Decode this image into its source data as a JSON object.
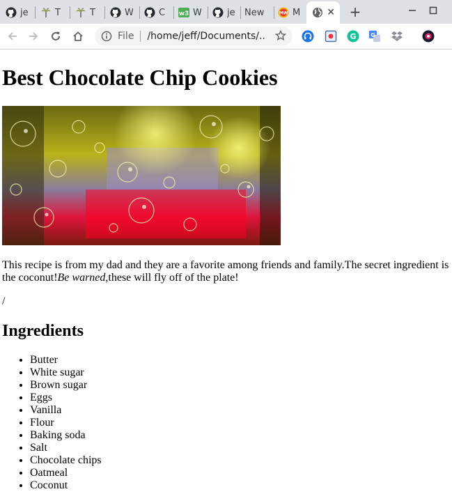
{
  "browser": {
    "tabs": [
      {
        "title": "jeff",
        "icon": "github-icon"
      },
      {
        "title": "T",
        "icon": "palm-tree-icon"
      },
      {
        "title": "T",
        "icon": "palm-tree-icon"
      },
      {
        "title": "W",
        "icon": "github-icon"
      },
      {
        "title": "C",
        "icon": "github-icon"
      },
      {
        "title": "W",
        "icon": "w3-icon"
      },
      {
        "title": "je",
        "icon": "github-icon"
      },
      {
        "title": "New",
        "icon": "none"
      },
      {
        "title": "M",
        "icon": "mw-icon"
      },
      {
        "title": "",
        "icon": "globe-icon",
        "active": true
      }
    ],
    "new_tab_label": "+",
    "close_label": "✕",
    "omnibox": {
      "scheme": "File",
      "url": "/home/jeff/Documents/..."
    }
  },
  "page": {
    "title": "Best Chocolate Chip Cookies",
    "intro_text": "This recipe is from my dad and they are a favorite among friends and family.The secret ingredient is the coconut!",
    "intro_emphasis": "Be warned",
    "intro_tail": ",these will fly off of the plate!",
    "slash_line": "/",
    "ingredients_heading": "Ingredients",
    "ingredients": [
      "Butter",
      "White sugar",
      "Brown sugar",
      "Eggs",
      "Vanilla",
      "Flour",
      "Baking soda",
      "Salt",
      "Chocolate chips",
      "Oatmeal",
      "Coconut"
    ]
  },
  "colors": {
    "tabstrip_bg": "#dee1e6",
    "omnibox_bg": "#f1f3f4",
    "icon_gray": "#5f6368"
  }
}
